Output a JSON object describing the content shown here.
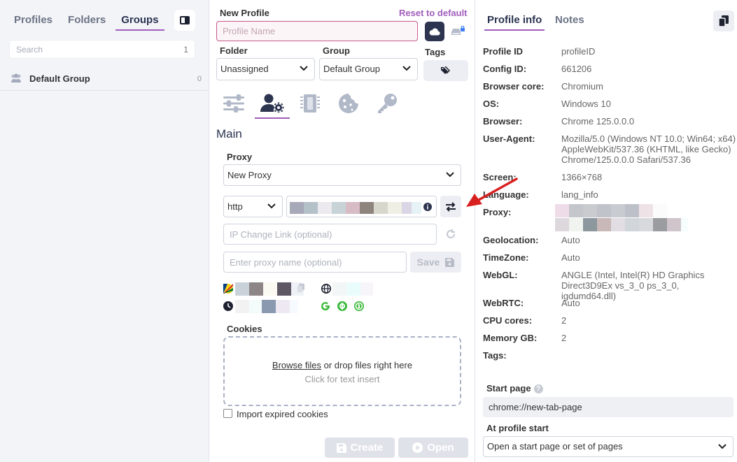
{
  "sidebar": {
    "tabs": [
      "Profiles",
      "Folders",
      "Groups"
    ],
    "active_tab": "Groups",
    "search": {
      "placeholder": "Search",
      "count": "1"
    },
    "groups": [
      {
        "name": "Default Group",
        "count": "0"
      }
    ]
  },
  "profile_form": {
    "new_profile_label": "New Profile",
    "reset_link": "Reset to default",
    "name_placeholder": "Profile Name",
    "folder_label": "Folder",
    "folder_value": "Unassigned",
    "group_label": "Group",
    "group_value": "Default Group",
    "tags_label": "Tags",
    "section_tabs": [
      "settings-sliders-icon",
      "user-gear-icon",
      "memory-chip-icon",
      "cookie-icon",
      "key-icon"
    ],
    "active_section_tab": "user-gear-icon",
    "section_title": "Main",
    "proxy": {
      "label": "Proxy",
      "selected": "New Proxy",
      "protocol": "http",
      "ip_change_placeholder": "IP Change Link (optional)",
      "name_placeholder": "Enter proxy name (optional)",
      "save_label": "Save"
    },
    "cookies": {
      "label": "Cookies",
      "browse_link": "Browse files",
      "drop_text": "or drop files right here",
      "click_text": "Click for text insert",
      "import_expired_label": "Import expired cookies"
    },
    "create_label": "Create",
    "open_label": "Open"
  },
  "profile_info": {
    "tabs": [
      "Profile info",
      "Notes"
    ],
    "active_tab": "Profile info",
    "rows": [
      {
        "key": "Profile ID",
        "value": "profileID"
      },
      {
        "key": "Config ID:",
        "value": "661206"
      },
      {
        "key": "Browser core:",
        "value": "Chromium"
      },
      {
        "key": "OS:",
        "value": "Windows 10"
      },
      {
        "key": "Browser:",
        "value": "Chrome 125.0.0.0"
      },
      {
        "key": "User-Agent:",
        "value": "Mozilla/5.0 (Windows NT 10.0; Win64; x64) AppleWebKit/537.36 (KHTML, like Gecko) Chrome/125.0.0.0 Safari/537.36"
      },
      {
        "key": "Screen:",
        "value": "1366×768"
      },
      {
        "key": "Language:",
        "value": "lang_info"
      },
      {
        "key": "Proxy:",
        "value": ""
      },
      {
        "key": "Geolocation:",
        "value": "Auto"
      },
      {
        "key": "TimeZone:",
        "value": "Auto"
      },
      {
        "key": "WebGL:",
        "value": "ANGLE (Intel, Intel(R) HD Graphics Direct3D9Ex vs_3_0 ps_3_0, igdumd64.dll)"
      },
      {
        "key": "WebRTC:",
        "value": "Auto"
      },
      {
        "key": "CPU cores:",
        "value": "2"
      },
      {
        "key": "Memory GB:",
        "value": "2"
      },
      {
        "key": "Tags:",
        "value": ""
      }
    ],
    "start_page_label": "Start page",
    "start_page_value": "chrome://new-tab-page",
    "at_start_label": "At profile start",
    "at_start_value": "Open a start page or set of pages"
  },
  "colors": {
    "accent": "#a05dbb",
    "navy": "#2d3450",
    "arrow": "#d92020",
    "green": "#3cba3c"
  }
}
